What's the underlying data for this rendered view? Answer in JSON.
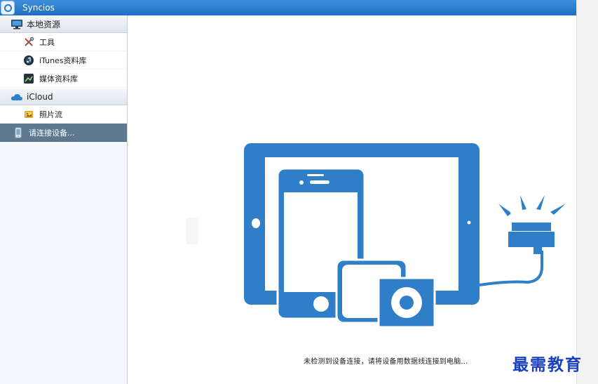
{
  "app": {
    "title": "Syncios"
  },
  "sidebar": {
    "groups": [
      {
        "label": "本地资源",
        "icon": "monitor-icon",
        "items": [
          {
            "label": "工具",
            "icon": "tools-icon"
          },
          {
            "label": "iTunes资料库",
            "icon": "itunes-icon"
          },
          {
            "label": "媒体资料库",
            "icon": "media-icon"
          }
        ]
      },
      {
        "label": "iCloud",
        "icon": "cloud-icon",
        "items": [
          {
            "label": "照片流",
            "icon": "photo-stream-icon"
          }
        ]
      }
    ],
    "device": {
      "label": "请连接设备...",
      "icon": "device-icon"
    }
  },
  "main": {
    "message": "未检测到设备连接，请将设备用数据线连接到电脑..."
  },
  "watermark": "最需教育",
  "colors": {
    "accent": "#2f7fc8",
    "titlebar": "#1f6ec4",
    "active_item": "#5e7890"
  }
}
